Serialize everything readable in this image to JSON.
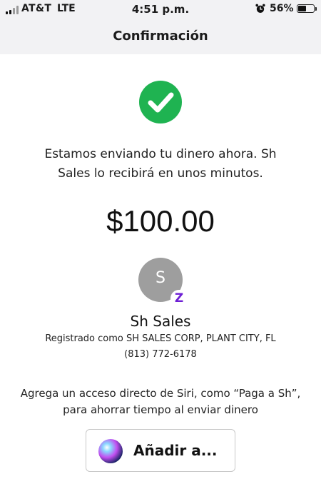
{
  "status_bar": {
    "carrier": "AT&T",
    "network": "LTE",
    "time": "4:51 p.m.",
    "battery_percent": "56%",
    "battery_level": 0.56,
    "icons": [
      "signal-icon",
      "alarm-clock-icon",
      "battery-icon"
    ]
  },
  "nav": {
    "title": "Confirmación"
  },
  "confirmation": {
    "icon": "checkmark-icon",
    "icon_color": "#1fb351",
    "message": "Estamos enviando tu dinero ahora. Sh Sales lo recibirá en unos minutos.",
    "amount": "$100.00"
  },
  "recipient": {
    "initial": "S",
    "badge": "Z",
    "badge_color": "#6d1ed4",
    "name": "Sh Sales",
    "registered": "Registrado como SH SALES CORP, PLANT CITY, FL",
    "phone": "(813) 772-6178"
  },
  "siri": {
    "hint": "Agrega un acceso directo de Siri, como “Paga a Sh”, para ahorrar tiempo al enviar dinero",
    "button_label": "Añadir a..."
  }
}
